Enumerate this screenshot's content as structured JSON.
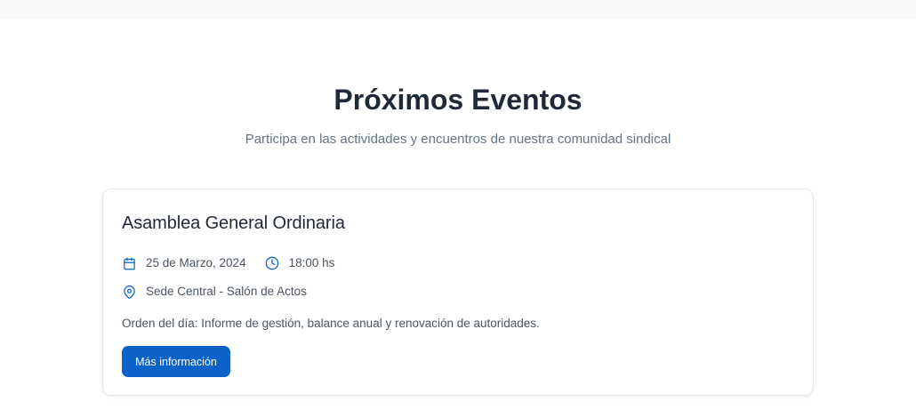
{
  "header": {
    "title": "Próximos Eventos",
    "subtitle": "Participa en las actividades y encuentros de nuestra comunidad sindical"
  },
  "events": [
    {
      "title": "Asamblea General Ordinaria",
      "date": "25 de Marzo, 2024",
      "time": "18:00 hs",
      "location": "Sede Central - Salón de Actos",
      "description": "Orden del día: Informe de gestión, balance anual y renovación de autoridades.",
      "button_label": "Más información",
      "icons": {
        "date": "calendar-icon",
        "time": "clock-icon",
        "location": "map-pin-icon"
      }
    }
  ],
  "colors": {
    "accent": "#0b63c9",
    "heading": "#1f2937",
    "muted": "#64748b",
    "card_border": "#e5e7eb"
  }
}
